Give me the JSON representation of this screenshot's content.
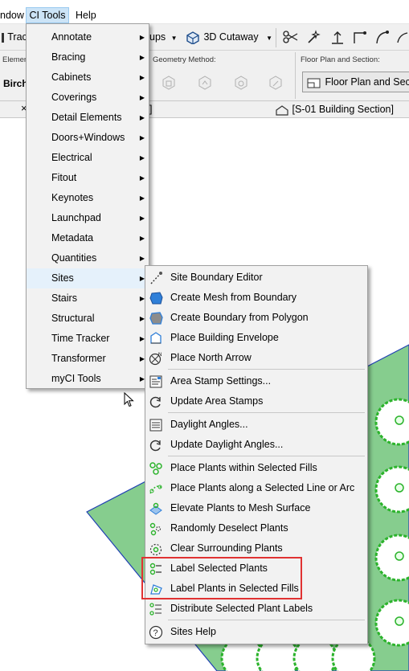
{
  "menubar": {
    "window": "ndow",
    "citools": "CI Tools",
    "help": "Help"
  },
  "toolbar": {
    "trace": "Trace",
    "groups": "ups",
    "cutaway": "3D Cutaway"
  },
  "infobox": {
    "element_label": "Elemen",
    "element_value": "Birch",
    "geometry_method_label": "Geometry Method:",
    "fp_section_label": "Floor Plan and Section:",
    "fp_section_button": "Floor Plan and Section"
  },
  "tabs": {
    "close_glyph": "×",
    "left_tab_fragment": "]",
    "section_tab": "[S-01 Building Section]"
  },
  "menu1": {
    "items": [
      {
        "label": "Annotate"
      },
      {
        "label": "Bracing"
      },
      {
        "label": "Cabinets"
      },
      {
        "label": "Coverings"
      },
      {
        "label": "Detail Elements"
      },
      {
        "label": "Doors+Windows"
      },
      {
        "label": "Electrical"
      },
      {
        "label": "Fitout"
      },
      {
        "label": "Keynotes"
      },
      {
        "label": "Launchpad"
      },
      {
        "label": "Metadata"
      },
      {
        "label": "Quantities"
      },
      {
        "label": "Sites"
      },
      {
        "label": "Stairs"
      },
      {
        "label": "Structural"
      },
      {
        "label": "Time Tracker"
      },
      {
        "label": "Transformer"
      },
      {
        "label": "myCI Tools"
      }
    ],
    "arrow_glyph": "▶"
  },
  "menu2": {
    "items": [
      {
        "label": "Site Boundary Editor",
        "icon": "site-boundary-editor-icon"
      },
      {
        "label": "Create Mesh from Boundary",
        "icon": "mesh-icon"
      },
      {
        "label": "Create Boundary from Polygon",
        "icon": "polygon-icon"
      },
      {
        "label": "Place Building Envelope",
        "icon": "building-envelope-icon"
      },
      {
        "label": "Place North Arrow",
        "icon": "north-arrow-icon"
      },
      {
        "label": "Area Stamp Settings...",
        "icon": "area-stamp-settings-icon"
      },
      {
        "label": "Update Area Stamps",
        "icon": "refresh-icon"
      },
      {
        "label": "Daylight Angles...",
        "icon": "daylight-angles-icon"
      },
      {
        "label": "Update Daylight Angles...",
        "icon": "refresh-icon"
      },
      {
        "label": "Place Plants within Selected Fills",
        "icon": "plants-in-fill-icon"
      },
      {
        "label": "Place Plants along a Selected Line or Arc",
        "icon": "plants-along-line-icon"
      },
      {
        "label": "Elevate Plants to Mesh Surface",
        "icon": "elevate-plants-icon"
      },
      {
        "label": "Randomly Deselect Plants",
        "icon": "deselect-plants-icon"
      },
      {
        "label": "Clear Surrounding Plants",
        "icon": "clear-plants-icon"
      },
      {
        "label": "Label Selected Plants",
        "icon": "label-plants-icon"
      },
      {
        "label": "Label Plants in Selected Fills",
        "icon": "label-fill-plants-icon"
      },
      {
        "label": "Distribute Selected Plant Labels",
        "icon": "distribute-labels-icon"
      },
      {
        "label": "Sites Help",
        "icon": "help-icon"
      }
    ]
  },
  "colors": {
    "fill_green": "#86cd8e",
    "plant_green": "#2bb32b",
    "highlight_red": "#e03232",
    "menu_hover": "#cce4f7"
  }
}
